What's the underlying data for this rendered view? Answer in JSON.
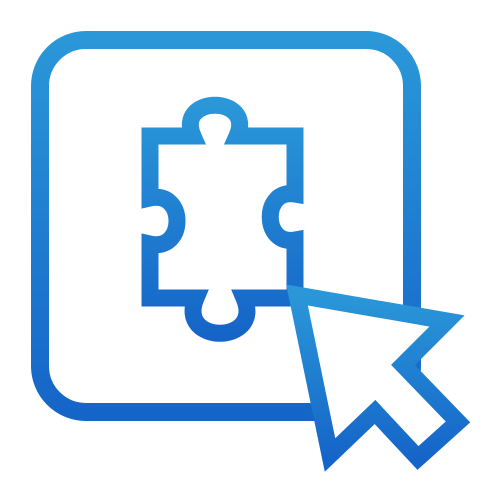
{
  "icon": {
    "name": "extension-cursor-icon",
    "parts": [
      "rounded-square-frame",
      "puzzle-piece-icon",
      "mouse-pointer-icon"
    ]
  },
  "colors": {
    "background": "#ffffff",
    "stroke_top": "#2a97d8",
    "stroke_bottom": "#1565c8",
    "pointer_fill": "#ffffff"
  }
}
